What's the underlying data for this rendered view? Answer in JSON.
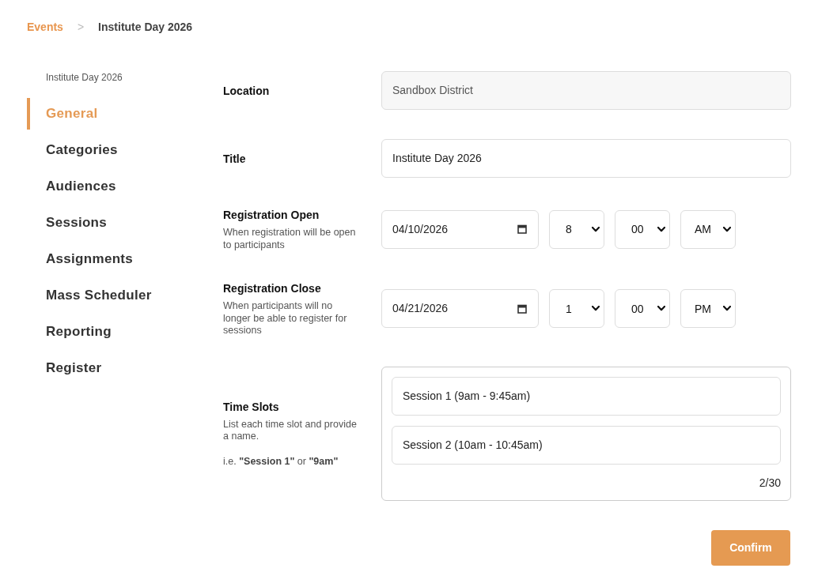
{
  "breadcrumb": [
    {
      "kind": "link",
      "label": "Events"
    },
    {
      "kind": "separator",
      "label": ">"
    },
    {
      "kind": "current",
      "label": "Institute Day 2026"
    }
  ],
  "sidebar": {
    "title": "Institute Day 2026",
    "items": [
      {
        "label": "General",
        "selected": true
      },
      {
        "label": "Categories",
        "selected": false
      },
      {
        "label": "Audiences",
        "selected": false
      },
      {
        "label": "Sessions",
        "selected": false
      },
      {
        "label": "Assignments",
        "selected": false
      },
      {
        "label": "Mass Scheduler",
        "selected": false
      },
      {
        "label": "Reporting",
        "selected": false
      },
      {
        "label": "Register",
        "selected": false
      }
    ]
  },
  "form": {
    "fields": [
      {
        "kind": "text",
        "label": "Location",
        "value": "Sandbox District",
        "disabled": true
      },
      {
        "kind": "text",
        "label": "Title",
        "value": "Institute Day 2026",
        "disabled": false
      },
      {
        "kind": "datetime",
        "label": "Registration Open",
        "help": "When registration will be open to participants",
        "date": "04/10/2026",
        "hour": "8",
        "minute": "00",
        "period": "AM"
      },
      {
        "kind": "datetime",
        "label": "Registration Close",
        "help": "When participants will no longer be able to register for sessions",
        "date": "04/21/2026",
        "hour": "1",
        "minute": "00",
        "period": "PM"
      }
    ],
    "time_slots": {
      "label": "Time Slots",
      "help": "List each time slot and provide a name.",
      "example": "i.e. **\"Session 1\"** or **\"9am\"**",
      "slots": [
        "Session 1 (9am - 9:45am)",
        "Session 2 (10am - 10:45am)"
      ],
      "count": "2/30"
    }
  },
  "buttons": [
    {
      "label": "Confirm"
    }
  ]
}
